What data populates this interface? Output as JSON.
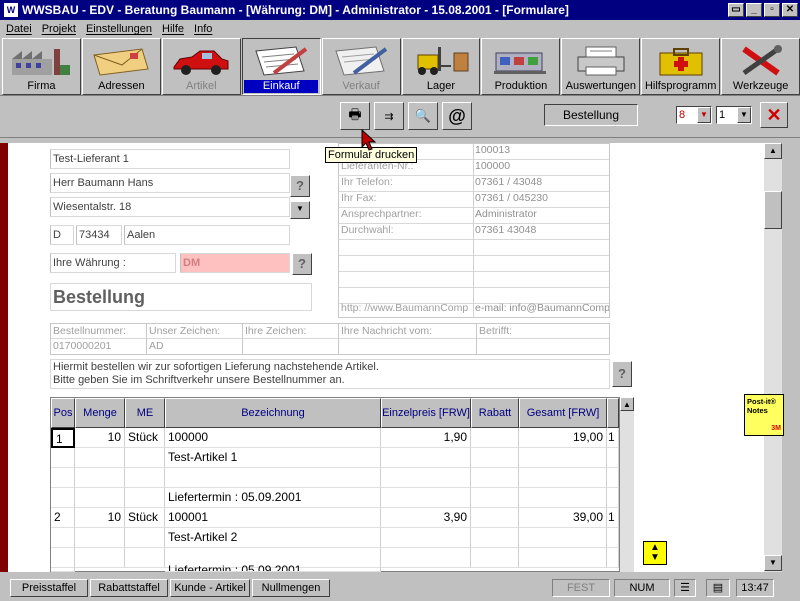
{
  "window": {
    "title": "WWSBAU - EDV - Beratung Baumann - [Währung: DM] - Administrator - 15.08.2001 - [Formulare]",
    "controls": [
      "▭",
      "_",
      "▫",
      "✕"
    ]
  },
  "menu": [
    "Datei",
    "Projekt",
    "Einstellungen",
    "Hilfe",
    "Info"
  ],
  "toolbar": [
    {
      "label": "Firma",
      "icon": "factory-icon"
    },
    {
      "label": "Adressen",
      "icon": "envelope-icon"
    },
    {
      "label": "Artikel",
      "icon": "car-icon"
    },
    {
      "label": "Einkauf",
      "icon": "pen-paper-icon"
    },
    {
      "label": "Verkauf",
      "icon": "pen-paper-icon"
    },
    {
      "label": "Lager",
      "icon": "forklift-icon"
    },
    {
      "label": "Produktion",
      "icon": "machine-icon"
    },
    {
      "label": "Auswertungen",
      "icon": "printer-icon"
    },
    {
      "label": "Hilfsprogramm",
      "icon": "first-aid-icon"
    },
    {
      "label": "Werkzeuge",
      "icon": "tools-icon"
    }
  ],
  "subtoolbar": {
    "document_type": "Bestellung",
    "copies_value": "8",
    "page_value": "1",
    "tooltip": "Formular drucken",
    "icons": [
      "print-icon",
      "transfer-icon",
      "preview-icon",
      "email-at-icon"
    ]
  },
  "supplier": {
    "name": "Test-Lieferant 1",
    "contact": "Herr Baumann Hans",
    "street": "Wiesentalstr. 18",
    "country": "D",
    "zip": "73434",
    "city": "Aalen",
    "currency_label": "Ihre Währung :",
    "currency_value": "DM"
  },
  "info_table": [
    {
      "label": "",
      "value": "100013"
    },
    {
      "label": "Lieferanten-Nr.:",
      "value": "100000"
    },
    {
      "label": "Ihr Telefon:",
      "value": "07361 / 43048"
    },
    {
      "label": "Ihr Fax:",
      "value": "07361 / 045230"
    },
    {
      "label": "Ansprechpartner:",
      "value": "Administrator"
    },
    {
      "label": "Durchwahl:",
      "value": "07361 43048"
    },
    {
      "label": "",
      "value": ""
    },
    {
      "label": "",
      "value": ""
    },
    {
      "label": "",
      "value": ""
    },
    {
      "label": "",
      "value": ""
    },
    {
      "label": "http: //www.BaumannComp",
      "value": "e-mail: info@BaumannComp"
    }
  ],
  "doc_title": "Bestellung",
  "reference": {
    "cols": [
      {
        "header": "Bestellnummer:",
        "value": "0170000201"
      },
      {
        "header": "Unser Zeichen:",
        "value": "AD"
      },
      {
        "header": "Ihre Zeichen:",
        "value": ""
      },
      {
        "header": "Ihre Nachricht vom:",
        "value": ""
      },
      {
        "header": "Betrifft:",
        "value": ""
      }
    ]
  },
  "intro": {
    "line1": "Hiermit bestellen wir zur sofortigen Lieferung nachstehende Artikel.",
    "line2": "Bitte geben Sie im Schriftverkehr unsere Bestellnummer an."
  },
  "items_table": {
    "headers": {
      "pos": "Pos",
      "qty": "Menge",
      "unit": "ME",
      "desc": "Bezeichnung",
      "price": "Einzelpreis [FRW]",
      "discount": "Rabatt",
      "total": "Gesamt [FRW]"
    },
    "rows": [
      {
        "pos": "1",
        "qty": "10",
        "unit": "Stück",
        "desc": "100000",
        "price": "1,90",
        "discount": "",
        "total": "19,00",
        "flag": "1"
      },
      {
        "pos": "",
        "qty": "",
        "unit": "",
        "desc": "Test-Artikel 1",
        "price": "",
        "discount": "",
        "total": "",
        "flag": ""
      },
      {
        "pos": "",
        "qty": "",
        "unit": "",
        "desc": "",
        "price": "",
        "discount": "",
        "total": "",
        "flag": ""
      },
      {
        "pos": "",
        "qty": "",
        "unit": "",
        "desc": "Liefertermin : 05.09.2001",
        "price": "",
        "discount": "",
        "total": "",
        "flag": ""
      },
      {
        "pos": "2",
        "qty": "10",
        "unit": "Stück",
        "desc": "100001",
        "price": "3,90",
        "discount": "",
        "total": "39,00",
        "flag": "1"
      },
      {
        "pos": "",
        "qty": "",
        "unit": "",
        "desc": "Test-Artikel 2",
        "price": "",
        "discount": "",
        "total": "",
        "flag": ""
      },
      {
        "pos": "",
        "qty": "",
        "unit": "",
        "desc": "",
        "price": "",
        "discount": "",
        "total": "",
        "flag": ""
      },
      {
        "pos": "",
        "qty": "",
        "unit": "",
        "desc": "Liefertermin : 05.09.2001",
        "price": "",
        "discount": "",
        "total": "",
        "flag": ""
      }
    ]
  },
  "postit": {
    "line1": "Post-it®",
    "line2": "Notes",
    "brand": "3M"
  },
  "statusbar": {
    "buttons": [
      "Preisstaffel",
      "Rabattstaffel",
      "Kunde - Artikel",
      "Nullmengen"
    ],
    "fest": "FEST",
    "num": "NUM",
    "time": "13:47"
  },
  "colors": {
    "titlebar": "#000080",
    "active_tab": "#0000c0",
    "currency_bg": "#ffc0c0",
    "close_x": "#d00000",
    "doc_edge": "#800000"
  }
}
